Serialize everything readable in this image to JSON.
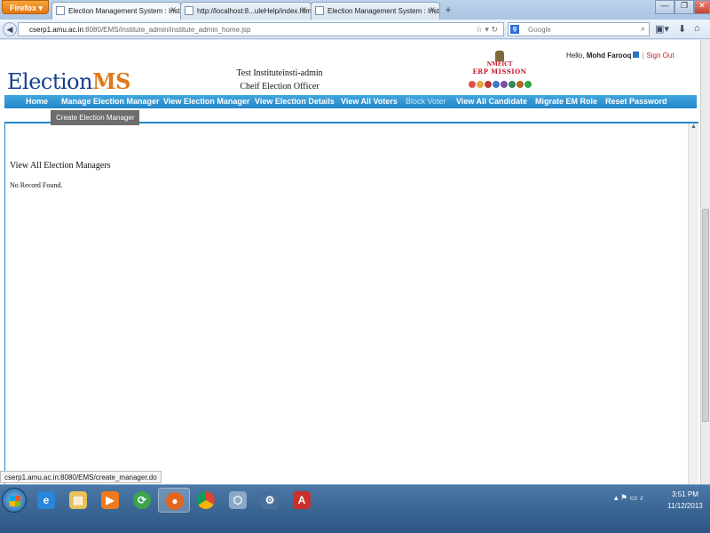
{
  "browser": {
    "menu_button": "Firefox",
    "tabs": [
      {
        "label": "Election Management System : Instit..."
      },
      {
        "label": "http://localhost:8...uleHelp/index.html"
      },
      {
        "label": "Election Management System : Instit..."
      }
    ],
    "new_tab": "+",
    "url_host": "cserp1.amu.ac.in",
    "url_path": ":8080/EMS/institute_admin/institute_admin_home.jsp",
    "search_placeholder": "Google",
    "status_url": "cserp1.amu.ac.in:8080/EMS/create_manager.do"
  },
  "header": {
    "greeting_prefix": "Hello,",
    "user_name": "Mohd Farooq",
    "sign_out": "Sign Out",
    "logo_part1": "Election",
    "logo_part2": "MS",
    "institute_line1": "Test Instituteinsti-admin",
    "institute_line2": "Cheif Election Officer",
    "emblem_line1": "NMEICT",
    "emblem_line2": "ERP MISSION"
  },
  "menu": {
    "items": [
      {
        "label": "Home"
      },
      {
        "label": "Manage Election Manager"
      },
      {
        "label": "View Election Manager"
      },
      {
        "label": "View Election Details"
      },
      {
        "label": "View All Voters"
      },
      {
        "label": "Block Voter"
      },
      {
        "label": "View All Candidate"
      },
      {
        "label": "Migrate EM Role"
      },
      {
        "label": "Reset Password"
      }
    ],
    "submenu_item": "Create Election Manager"
  },
  "content": {
    "title": "View All Election Managers",
    "message": "No Record Found."
  },
  "taskbar": {
    "time": "3:51 PM",
    "date": "11/12/2013"
  },
  "colors": {
    "menu_bar": "#2487c9",
    "logo_blue": "#163f8e",
    "logo_orange": "#e07a1b",
    "sign_out": "#c0222a"
  }
}
